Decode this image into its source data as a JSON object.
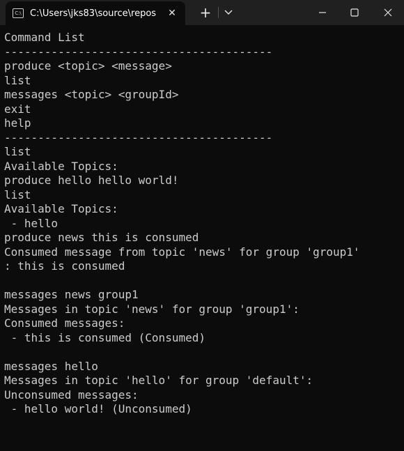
{
  "window": {
    "tab_title": "C:\\Users\\jks83\\source\\repos",
    "tab_icon": "C:\\",
    "new_tab_label": "+",
    "close_tab_label": "✕"
  },
  "terminal": {
    "lines": [
      "Command List",
      "----------------------------------------",
      "produce <topic> <message>",
      "list",
      "messages <topic> <groupId>",
      "exit",
      "help",
      "----------------------------------------",
      "list",
      "Available Topics:",
      "produce hello hello world!",
      "list",
      "Available Topics:",
      " - hello",
      "produce news this is consumed",
      "Consumed message from topic 'news' for group 'group1'",
      ": this is consumed",
      "",
      "messages news group1",
      "Messages in topic 'news' for group 'group1':",
      "Consumed messages:",
      " - this is consumed (Consumed)",
      "",
      "messages hello",
      "Messages in topic 'hello' for group 'default':",
      "Unconsumed messages:",
      " - hello world! (Unconsumed)"
    ]
  },
  "colors": {
    "titlebar": "#202020",
    "terminal_bg": "#0c0c0c",
    "terminal_fg": "#cccccc"
  }
}
